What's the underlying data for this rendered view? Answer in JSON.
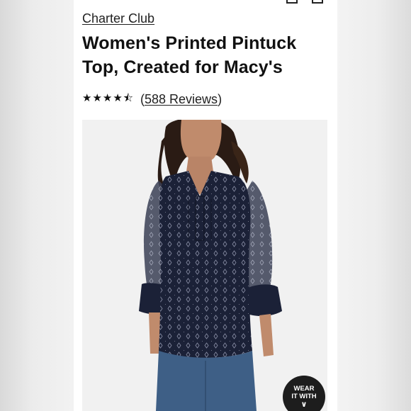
{
  "product": {
    "brand": "Charter Club",
    "title": "Women's Printed Pintuck Top, Created for Macy's",
    "rating_value": 4.5,
    "rating_stars": "★★★★⯪",
    "reviews_label": "588 Reviews",
    "reviews_open": "(",
    "reviews_close": ")"
  },
  "image": {
    "icon": "product-photo",
    "alt": "Women's Printed Pintuck Top"
  },
  "wear_it_with": {
    "line1": "WEAR",
    "line2": "IT WITH",
    "chevron": "∨"
  },
  "colors": {
    "top_navy": "#1b2137",
    "denim": "#3e5f86",
    "skin": "#b98467",
    "hair": "#2a1b14"
  }
}
